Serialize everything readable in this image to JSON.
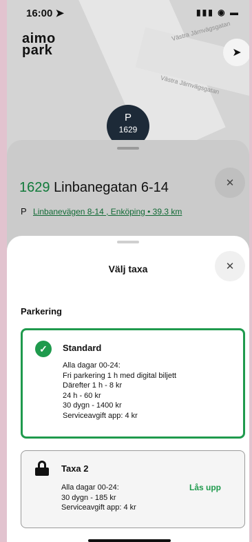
{
  "status_bar": {
    "time": "16:00",
    "icons": "signal-wifi-battery"
  },
  "map": {
    "logo_line1": "aimo",
    "logo_line2": "park",
    "street_label_top": "Västra Järnvägsgatan",
    "street_label_mid": "Västra Järnvägsgatan",
    "marker_letter": "P",
    "marker_number": "1629"
  },
  "spot_sheet": {
    "number": "1629",
    "name": "Linbanegatan 6-14",
    "address_icon": "P",
    "address_link": "Linbanevägen 8-14 , Enköping • 39.3 km"
  },
  "modal": {
    "title": "Välj taxa",
    "section_title": "Parkering",
    "tariffs": [
      {
        "name": "Standard",
        "selected": true,
        "lines": [
          "Alla dagar 00-24:",
          "Fri parkering 1 h med digital biljett",
          "Därefter 1 h - 8 kr",
          "24 h - 60 kr",
          "30 dygn - 1400 kr",
          "Serviceavgift app: 4 kr"
        ]
      },
      {
        "name": "Taxa 2",
        "selected": false,
        "locked": true,
        "action_label": "Lås upp",
        "lines": [
          "Alla dagar 00-24:",
          "30 dygn - 185 kr",
          "Serviceavgift app: 4 kr"
        ]
      }
    ]
  },
  "colors": {
    "accent_green": "#1f9a4d",
    "marker_navy": "#1d2a38"
  }
}
